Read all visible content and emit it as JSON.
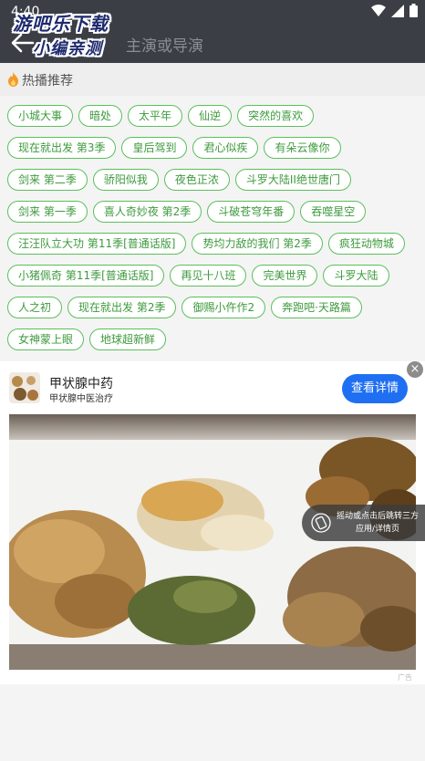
{
  "status_bar": {
    "time": "4:40",
    "icons": [
      "wifi-icon",
      "signal-icon",
      "battery-icon"
    ]
  },
  "watermark": {
    "line1": "游吧乐下载",
    "line2": "小编亲测"
  },
  "search": {
    "placeholder": "主演或导演"
  },
  "hot_section": {
    "icon": "fire-icon",
    "title": "热播推荐",
    "tags": [
      "小城大事",
      "暗处",
      "太平年",
      "仙逆",
      "突然的喜欢",
      "现在就出发 第3季",
      "皇后驾到",
      "君心似疾",
      "有朵云像你",
      "剑来 第二季",
      "骄阳似我",
      "夜色正浓",
      "斗罗大陆II绝世唐门",
      "剑来 第一季",
      "喜人奇妙夜 第2季",
      "斗破苍穹年番",
      "吞噬星空",
      "汪汪队立大功 第11季[普通话版]",
      "势均力敌的我们 第2季",
      "疯狂动物城",
      "小猪佩奇 第11季[普通话版]",
      "再见十八班",
      "完美世界",
      "斗罗大陆",
      "人之初",
      "现在就出发 第2季",
      "御赐小仵作2",
      "奔跑吧·天路篇",
      "女神蒙上眼",
      "地球超新鲜"
    ]
  },
  "ad": {
    "title": "甲状腺中药",
    "subtitle": "甲状腺中医治疗",
    "button": "查看详情",
    "close": "×",
    "overlay_text": "摇动或点击后跳转三方应用/详情页",
    "ad_mark": "广告",
    "accent_color": "#1f6ff2"
  },
  "colors": {
    "topbar": "#3b3f45",
    "tag_border": "#5bbf5b",
    "tag_text": "#3e9a3e"
  }
}
